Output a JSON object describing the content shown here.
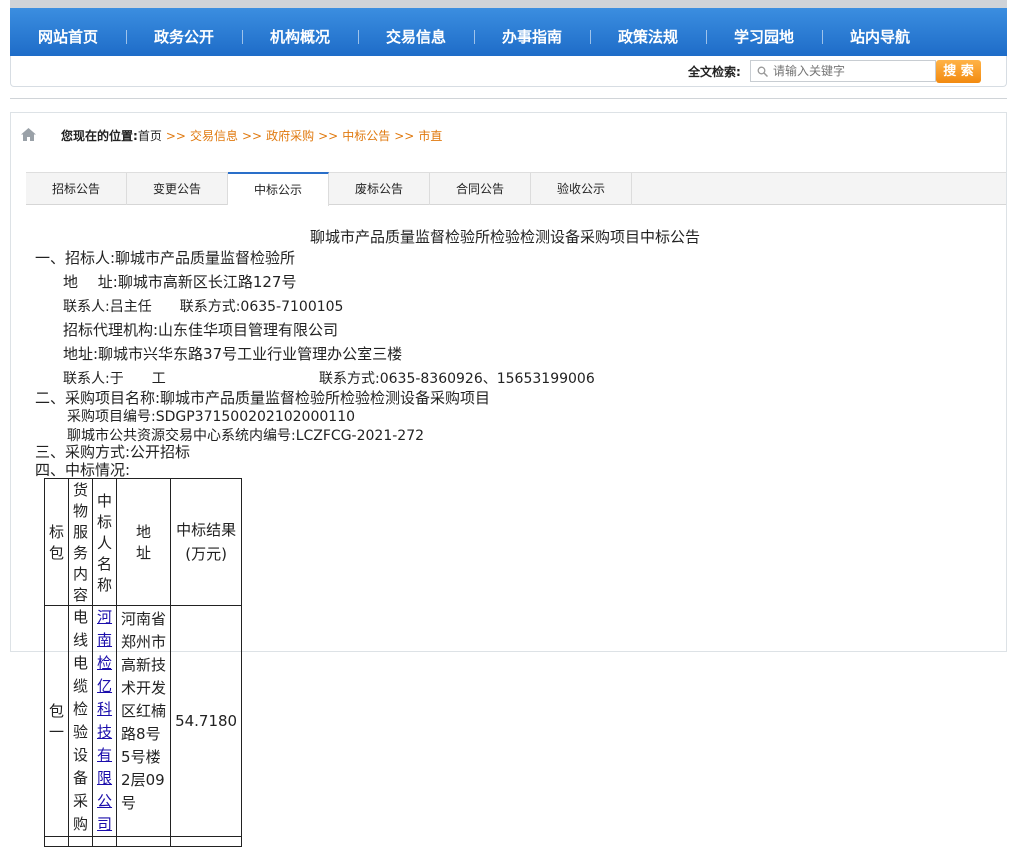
{
  "nav": [
    "网站首页",
    "政务公开",
    "机构概况",
    "交易信息",
    "办事指南",
    "政策法规",
    "学习园地",
    "站内导航"
  ],
  "search": {
    "label": "全文检索:",
    "placeholder": "请输入关键字",
    "button": "搜 索"
  },
  "breadcrumb": {
    "lead": "您现在的位置:",
    "home": "首页",
    "sep": ">>",
    "items": [
      "交易信息",
      "政府采购",
      "中标公告",
      "市直"
    ]
  },
  "tabs": [
    "招标公告",
    "变更公告",
    "中标公示",
    "废标公告",
    "合同公告",
    "验收公示"
  ],
  "active_tab": "中标公示",
  "doc": {
    "title": "聊城市产品质量监督检验所检验检测设备采购项目中标公告",
    "s1": "一、招标人:聊城市产品质量监督检验所",
    "addr1": "地　 址:聊城市高新区长江路127号",
    "contact1": "联系人:吕主任　　联系方式:0635-7100105",
    "agency": "招标代理机构:山东佳华项目管理有限公司",
    "addr2": "地址:聊城市兴华东路37号工业行业管理办公室三楼",
    "contact2_name": "联系人:于　　工",
    "contact2_phone": "联系方式:0635-8360926、15653199006",
    "s2": "二、采购项目名称:聊城市产品质量监督检验所检验检测设备采购项目",
    "proj_no": "采购项目编号:SDGP371500202102000110",
    "sys_no": "聊城市公共资源交易中心系统内编号:LCZFCG-2021-272",
    "s3": "三、采购方式:公开招标",
    "s4": "四、中标情况:"
  },
  "table": {
    "headers": [
      "标包",
      "货物服务内容",
      "中标人名称",
      "地　　址",
      "中标结果\n(万元)"
    ],
    "row": {
      "package": "包一",
      "content": "电线电缆检验设备采购",
      "winner": "河南检亿科技有限公司",
      "address": "河南省郑州市高新技术开发区红楠路8号5号楼2层09号",
      "amount": "54.7180"
    }
  }
}
